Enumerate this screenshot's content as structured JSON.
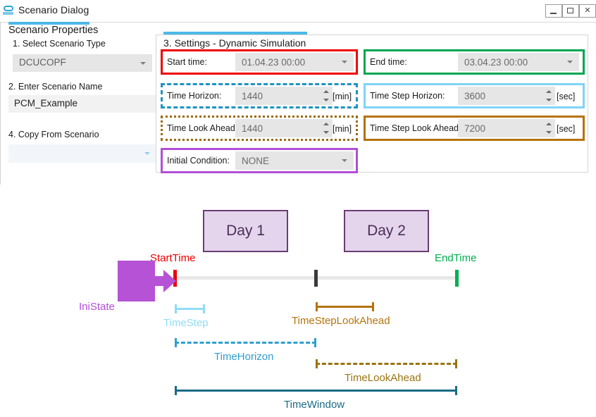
{
  "window": {
    "title": "Scenario Dialog",
    "icon": "app-logo-icon",
    "minimize_label": "",
    "maximize_label": "",
    "close_label": "✕"
  },
  "left_panel": {
    "title": "Scenario Properties",
    "step1_label": "1. Select Scenario Type",
    "scenario_type_value": "DCUCOPF",
    "step2_label": "2. Enter Scenario Name",
    "scenario_name_value": "PCM_Example",
    "step4_label": "4. Copy From Scenario",
    "copy_from_value": ""
  },
  "settings_group": {
    "title": "3. Settings - Dynamic Simulation",
    "fields": [
      {
        "key": "start_time",
        "label": "Start time:",
        "value": "01.04.23 00:00",
        "unit": "",
        "control": "combo",
        "border_color": "#ee0000",
        "border_style": "solid"
      },
      {
        "key": "end_time",
        "label": "End time:",
        "value": "03.04.23 00:00",
        "unit": "",
        "control": "combo",
        "border_color": "#00a650",
        "border_style": "solid"
      },
      {
        "key": "time_horizon",
        "label": "Time Horizon:",
        "value": "1440",
        "unit": "[min]",
        "control": "spinner",
        "border_color": "#1f93c0",
        "border_style": "dashed"
      },
      {
        "key": "time_step_horizon",
        "label": "Time Step Horizon:",
        "value": "3600",
        "unit": "[sec]",
        "control": "spinner",
        "border_color": "#7fd4f7",
        "border_style": "solid"
      },
      {
        "key": "time_look_ahead",
        "label": "Time Look Ahead:",
        "value": "1440",
        "unit": "[min]",
        "control": "spinner",
        "border_color": "#9a6a0a",
        "border_style": "dotted"
      },
      {
        "key": "time_step_look_ahead",
        "label": "Time Step Look Ahead:",
        "value": "7200",
        "unit": "[sec]",
        "control": "spinner",
        "border_color": "#b5730a",
        "border_style": "solid"
      },
      {
        "key": "initial_condition",
        "label": "Initial Condition:",
        "value": "NONE",
        "unit": "",
        "control": "combo",
        "border_color": "#b14fd8",
        "border_style": "solid"
      }
    ]
  },
  "diagram": {
    "day_boxes": [
      {
        "label": "Day 1"
      },
      {
        "label": "Day 2"
      }
    ],
    "markers": [
      {
        "key": "start_time",
        "label": "StartTime",
        "color": "#ee0000"
      },
      {
        "key": "end_time",
        "label": "EndTime",
        "color": "#00b050"
      },
      {
        "key": "initial_state",
        "label": "IniState",
        "color": "#b14fd8"
      }
    ],
    "spans": [
      {
        "key": "time_step",
        "label": "TimeStep",
        "color": "#8fdcf7",
        "style": "solid"
      },
      {
        "key": "time_step_look_ahead",
        "label": "TimeStepLookAhead",
        "color": "#b5730a",
        "style": "solid"
      },
      {
        "key": "time_horizon",
        "label": "TimeHorizon",
        "color": "#2f9fd0",
        "style": "dashed"
      },
      {
        "key": "time_look_ahead",
        "label": "TimeLookAhead",
        "color": "#9a7411",
        "style": "dashed"
      },
      {
        "key": "time_window",
        "label": "TimeWindow",
        "color": "#1b6b86",
        "style": "solid"
      }
    ]
  }
}
